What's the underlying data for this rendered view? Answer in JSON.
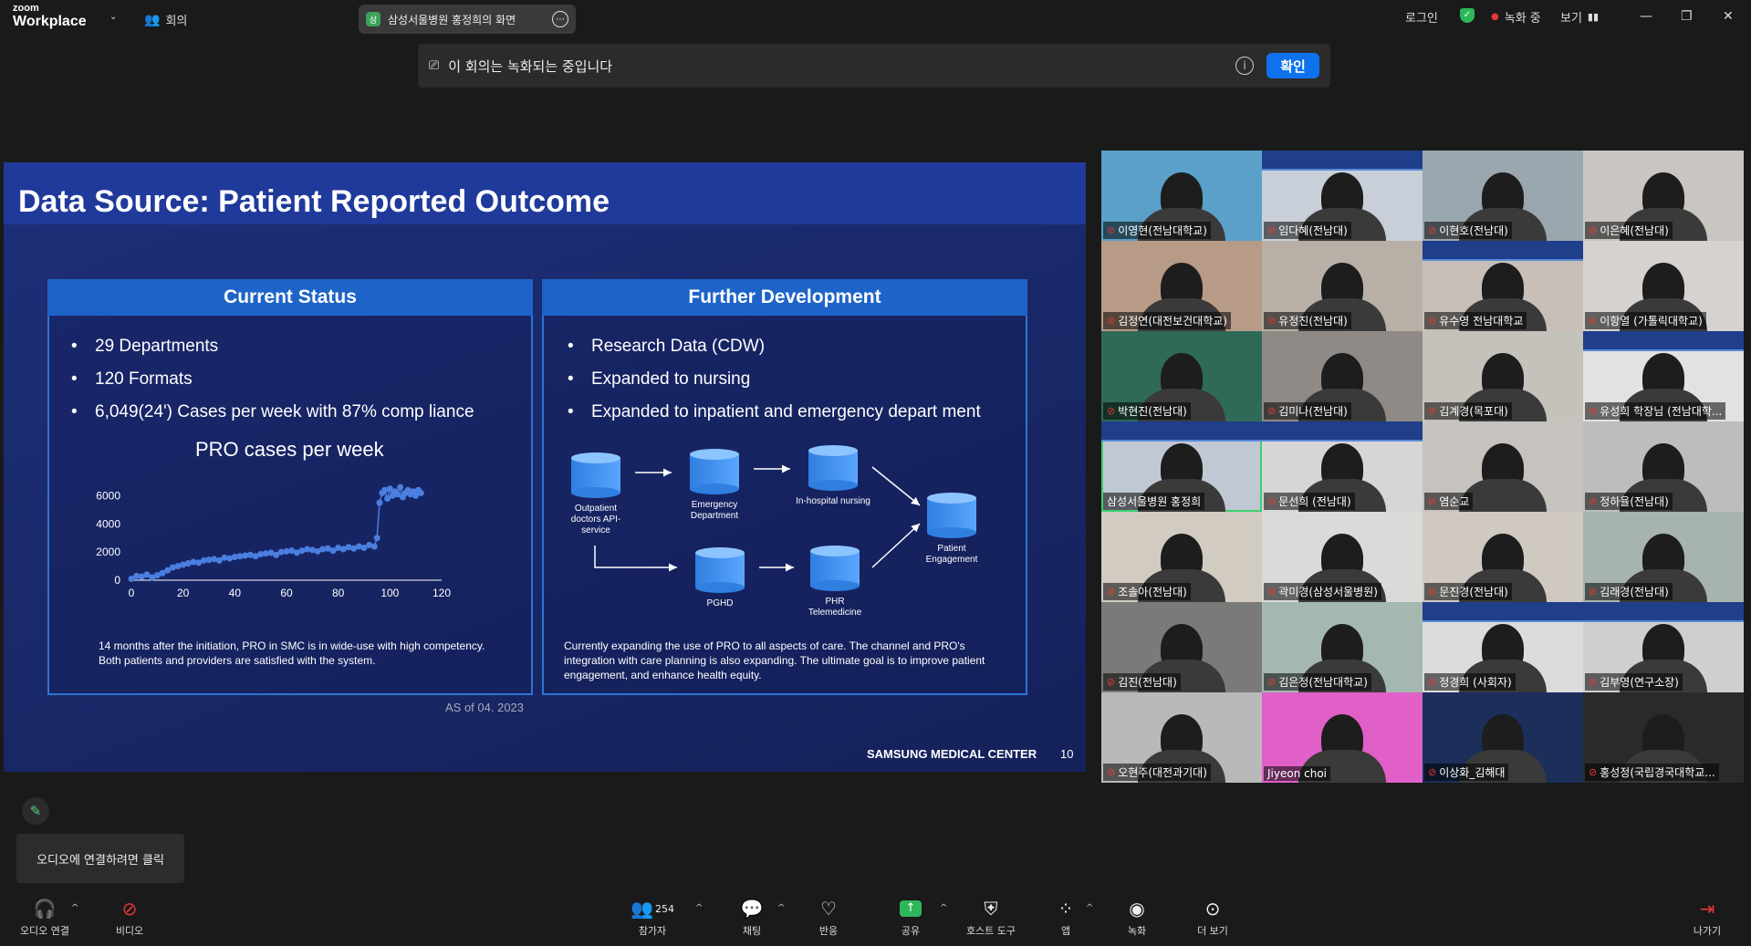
{
  "app": {
    "logo_top": "zoom",
    "logo_bottom": "Workplace",
    "meeting_menu": "회의",
    "share_pill": "삼성서울병원 홍정희의 화면",
    "share_pill_icon": "삼",
    "login": "로그인",
    "recording": "녹화 중",
    "view": "보기"
  },
  "banner": {
    "text": "이 회의는 녹화되는 중입니다",
    "confirm": "확인"
  },
  "slide": {
    "title": "Data Source: Patient Reported Outcome",
    "left_panel": {
      "header": "Current Status",
      "bullets": [
        "29 Departments",
        "120 Formats",
        "6,049(24') Cases per week with 87% comp liance"
      ],
      "chart_title": "PRO cases per week",
      "note": "14 months after the initiation, PRO in SMC is in wide-use with high competency. Both patients and providers are satisfied with the system."
    },
    "right_panel": {
      "header": "Further Development",
      "bullets": [
        "Research Data (CDW)",
        "Expanded to nursing",
        "Expanded to inpatient and emergency depart ment"
      ],
      "nodes": {
        "outpatient": "Outpatient doctors API-service",
        "emergency": "Emergency Department",
        "inhospital": "In-hospital nursing",
        "pghd": "PGHD",
        "phr": "PHR Telemedicine",
        "engagement": "Patient Engagement"
      },
      "note": "Currently expanding the use of PRO to all aspects of care. The channel and PRO's integration with care planning is also expanding. The ultimate goal is to improve patient engagement, and enhance health equity."
    },
    "as_of": "AS of 04. 2023",
    "footer": "SAMSUNG MEDICAL CENTER",
    "page": "10"
  },
  "chart_data": {
    "type": "scatter",
    "title": "PRO cases per week",
    "xlabel": "",
    "ylabel": "",
    "xlim": [
      0,
      120
    ],
    "ylim": [
      0,
      7000
    ],
    "x_ticks": [
      0,
      20,
      40,
      60,
      80,
      100,
      120
    ],
    "y_ticks": [
      0,
      2000,
      4000,
      6000
    ],
    "series": [
      {
        "x": [
          0,
          2,
          4,
          6,
          8,
          10,
          12,
          14,
          16,
          18,
          20,
          22,
          24,
          26,
          28,
          30,
          32,
          34,
          36,
          38,
          40,
          42,
          44,
          46,
          48,
          50,
          52,
          54,
          56,
          58,
          60,
          62,
          64,
          66,
          68,
          70,
          72,
          74,
          76,
          78,
          80,
          82,
          84,
          86,
          88,
          90,
          92,
          94,
          95,
          96,
          97,
          98,
          99,
          100,
          101,
          102,
          103,
          104,
          105,
          106,
          107,
          108,
          109,
          110,
          111,
          112
        ],
        "y": [
          100,
          300,
          250,
          400,
          200,
          350,
          500,
          700,
          900,
          1000,
          1100,
          1200,
          1300,
          1250,
          1400,
          1450,
          1500,
          1400,
          1600,
          1550,
          1650,
          1700,
          1750,
          1800,
          1700,
          1850,
          1900,
          1950,
          1800,
          2000,
          2050,
          2100,
          1950,
          2100,
          2200,
          2150,
          2050,
          2200,
          2250,
          2100,
          2300,
          2200,
          2350,
          2250,
          2400,
          2300,
          2500,
          2400,
          3000,
          5500,
          6200,
          6400,
          5800,
          6500,
          6000,
          6300,
          6100,
          6600,
          5900,
          6200,
          6400,
          6100,
          6300,
          6000,
          6400,
          6200
        ]
      }
    ]
  },
  "grid": {
    "tiles": [
      {
        "name": "이영현(전남대학교)",
        "bg": "#5aa0c8",
        "muted": true
      },
      {
        "name": "임다혜(전남대)",
        "bg": "#c8cfd8",
        "muted": true,
        "banner": true
      },
      {
        "name": "이현호(전남대)",
        "bg": "#9aa7ae",
        "muted": true
      },
      {
        "name": "이은혜(전남대)",
        "bg": "#c9c5c1",
        "muted": true
      },
      {
        "name": "김정연(대전보건대학교)",
        "bg": "#b79b86",
        "muted": true
      },
      {
        "name": "유정진(전남대)",
        "bg": "#b8b0a6",
        "muted": true
      },
      {
        "name": "유수영 전남대학교",
        "bg": "#c8c0b8",
        "muted": true,
        "banner": true
      },
      {
        "name": "이항열 (가톨릭대학교)",
        "bg": "#d5d2cf",
        "muted": true
      },
      {
        "name": "박현진(전남대)",
        "bg": "#2f6a58",
        "muted": true
      },
      {
        "name": "김미나(전남대)",
        "bg": "#8f8a86",
        "muted": true
      },
      {
        "name": "김계경(목포대)",
        "bg": "#c5c1bb",
        "muted": true
      },
      {
        "name": "유성희 학장님 (전남대학...",
        "bg": "#e2e2e2",
        "muted": true,
        "banner": true
      },
      {
        "name": "삼성서울병원 홍정희",
        "bg": "#c0c8d4",
        "muted": false,
        "banner": true,
        "active": true
      },
      {
        "name": "문선희 (전남대)",
        "bg": "#d6d6d6",
        "muted": true,
        "banner": true
      },
      {
        "name": "염순교",
        "bg": "#c6c2be",
        "muted": true
      },
      {
        "name": "정하율(전남대)",
        "bg": "#bdbdbd",
        "muted": true
      },
      {
        "name": "조솔아(전남대)",
        "bg": "#d1cbc2",
        "muted": true
      },
      {
        "name": "곽미경(삼성서울병원)",
        "bg": "#d9dbd8",
        "muted": true
      },
      {
        "name": "문진경(전남대)",
        "bg": "#cfc9c1",
        "muted": true
      },
      {
        "name": "김래경(전남대)",
        "bg": "#a7b3ad",
        "muted": true
      },
      {
        "name": "김진(전남대)",
        "bg": "#7a7a78",
        "muted": true
      },
      {
        "name": "김은정(전남대학교)",
        "bg": "#a4b8b0",
        "muted": true
      },
      {
        "name": "정경희 (사회자)",
        "bg": "#dcdcdc",
        "muted": true,
        "banner": true
      },
      {
        "name": "김부영(연구소장)",
        "bg": "#cfcfcf",
        "muted": true,
        "banner": true
      },
      {
        "name": "오현주(대전과기대)",
        "bg": "#b9b9b9",
        "muted": true
      },
      {
        "name": "Jiyeon choi",
        "bg": "#e060c8",
        "muted": false
      },
      {
        "name": "이상화_김해대",
        "bg": "#1b2f5a",
        "muted": true
      },
      {
        "name": "홍성정(국립경국대학교...",
        "bg": "#2a2a2a",
        "muted": true
      }
    ]
  },
  "bottom": {
    "audio_tip": "오디오에 연결하려면 클릭",
    "audio": "오디오 연결",
    "video": "비디오",
    "participants": "참가자",
    "participants_count": "254",
    "chat": "채팅",
    "react": "반응",
    "share": "공유",
    "host_tools": "호스트 도구",
    "apps": "앱",
    "record": "녹화",
    "more": "더 보기",
    "leave": "나가기"
  },
  "colors": {
    "accent": "#0e72ed",
    "slide_bg": "#1a2a6c",
    "panel_header": "#1e64c8",
    "point": "#4a7fe0"
  },
  "icons": [
    "chevron-down-icon",
    "people-icon",
    "shield-check-icon",
    "record-dot-icon",
    "video-camera-icon",
    "info-icon",
    "pencil-icon",
    "headphones-icon",
    "video-off-icon",
    "chat-icon",
    "heart-icon",
    "share-arrow-icon",
    "host-shield-icon",
    "apps-icon",
    "record-icon",
    "more-icon",
    "leave-icon"
  ]
}
